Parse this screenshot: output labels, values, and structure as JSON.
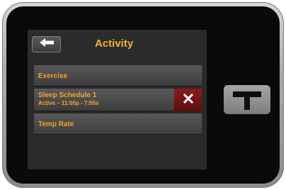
{
  "header": {
    "title": "Activity",
    "back_icon": "left-arrow-icon"
  },
  "list": {
    "items": [
      {
        "label": "Exercise"
      },
      {
        "label": "Sleep Schedule 1",
        "sublabel": "Active – 11:00p - 7:00a",
        "delete_icon": "close-icon"
      },
      {
        "label": "Temp Rate"
      }
    ]
  },
  "device": {
    "home_button_icon": "t-logo-icon"
  },
  "colors": {
    "accent_text": "#f2a32b",
    "title_text": "#f2b233",
    "delete_bg": "#8e1a1a",
    "screen_bg": "#2a2a2a",
    "bezel": "#0a0a0a"
  }
}
